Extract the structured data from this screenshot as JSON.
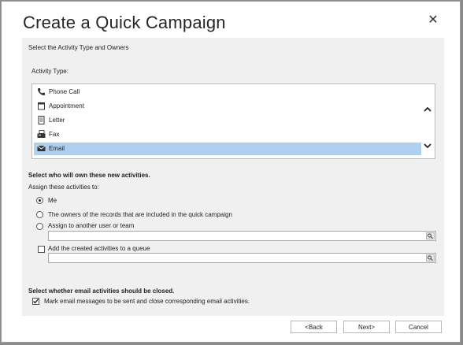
{
  "dialog": {
    "title": "Create a Quick Campaign",
    "close_glyph": "✕"
  },
  "activity_section": {
    "heading": "Select the Activity Type and Owners",
    "list_label": "Activity Type:",
    "items": [
      {
        "label": "Phone Call",
        "icon": "phone-icon",
        "selected": false
      },
      {
        "label": "Appointment",
        "icon": "appointment-icon",
        "selected": false
      },
      {
        "label": "Letter",
        "icon": "letter-icon",
        "selected": false
      },
      {
        "label": "Fax",
        "icon": "fax-icon",
        "selected": false
      },
      {
        "label": "Email",
        "icon": "email-icon",
        "selected": true
      }
    ]
  },
  "owner_section": {
    "heading": "Select who will own these new activities.",
    "subheading": "Assign these activities to:",
    "options": [
      {
        "label": "Me",
        "checked": true
      },
      {
        "label": "The owners of the records that are included in the quick campaign",
        "checked": false
      },
      {
        "label": "Assign to another user or team",
        "checked": false
      }
    ],
    "user_lookup_value": "",
    "queue_checkbox_label": "Add the created activities to a queue",
    "queue_checkbox_checked": false,
    "queue_lookup_value": ""
  },
  "email_section": {
    "heading": "Select whether email activities should be closed.",
    "checkbox_label": "Mark email messages to be sent and close corresponding email activities.",
    "checkbox_checked": true
  },
  "footer": {
    "back_label": "<Back",
    "next_label": "Next>",
    "cancel_label": "Cancel"
  },
  "colors": {
    "selected_row": "#afcfee",
    "content_bg": "#f0f0f0"
  }
}
